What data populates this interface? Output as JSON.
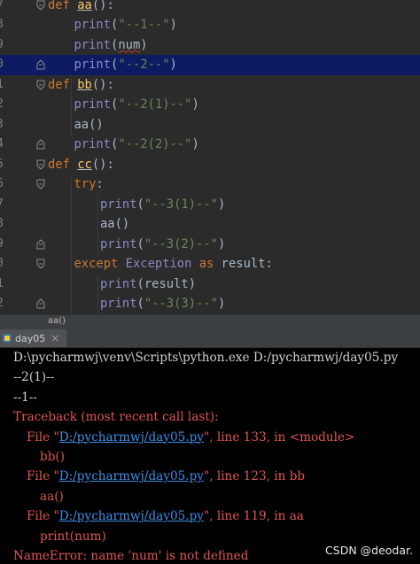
{
  "editor": {
    "lines": [
      {
        "num": "7",
        "indent": 0,
        "tokens": [
          {
            "t": "def ",
            "c": "kw"
          },
          {
            "t": "aa",
            "c": "fn-u"
          },
          {
            "t": "():",
            "c": "plain"
          }
        ],
        "mark": "fold"
      },
      {
        "num": "8",
        "indent": 1,
        "tokens": [
          {
            "t": "print",
            "c": "bi"
          },
          {
            "t": "(",
            "c": "plain"
          },
          {
            "t": "\"--1--\"",
            "c": "str"
          },
          {
            "t": ")",
            "c": "plain"
          }
        ],
        "mark": ""
      },
      {
        "num": "9",
        "indent": 1,
        "tokens": [
          {
            "t": "print",
            "c": "bi"
          },
          {
            "t": "(",
            "c": "plain"
          },
          {
            "t": "num",
            "c": "var-sq"
          },
          {
            "t": ")",
            "c": "plain"
          }
        ],
        "mark": ""
      },
      {
        "num": "0",
        "indent": 1,
        "tokens": [
          {
            "t": "print",
            "c": "bi"
          },
          {
            "t": "(",
            "c": "plain"
          },
          {
            "t": "\"--2--\"",
            "c": "str"
          },
          {
            "t": ")",
            "c": "plain"
          }
        ],
        "mark": "end",
        "active": true
      },
      {
        "num": "1",
        "indent": 0,
        "tokens": [
          {
            "t": "def ",
            "c": "kw"
          },
          {
            "t": "bb",
            "c": "fn-u"
          },
          {
            "t": "():",
            "c": "plain"
          }
        ],
        "mark": "fold"
      },
      {
        "num": "2",
        "indent": 1,
        "tokens": [
          {
            "t": "print",
            "c": "bi"
          },
          {
            "t": "(",
            "c": "plain"
          },
          {
            "t": "\"--2(1)--\"",
            "c": "str"
          },
          {
            "t": ")",
            "c": "plain"
          }
        ],
        "mark": ""
      },
      {
        "num": "3",
        "indent": 1,
        "tokens": [
          {
            "t": "aa",
            "c": "plain"
          },
          {
            "t": "()",
            "c": "plain"
          }
        ],
        "mark": ""
      },
      {
        "num": "4",
        "indent": 1,
        "tokens": [
          {
            "t": "print",
            "c": "bi"
          },
          {
            "t": "(",
            "c": "plain"
          },
          {
            "t": "\"--2(2)--\"",
            "c": "str"
          },
          {
            "t": ")",
            "c": "plain"
          }
        ],
        "mark": "end"
      },
      {
        "num": "5",
        "indent": 0,
        "tokens": [
          {
            "t": "def ",
            "c": "kw"
          },
          {
            "t": "cc",
            "c": "fn-u"
          },
          {
            "t": "():",
            "c": "plain"
          }
        ],
        "mark": "fold"
      },
      {
        "num": "6",
        "indent": 1,
        "tokens": [
          {
            "t": "try",
            "c": "kw"
          },
          {
            "t": ":",
            "c": "plain"
          }
        ],
        "mark": "fold"
      },
      {
        "num": "7",
        "indent": 2,
        "tokens": [
          {
            "t": "print",
            "c": "bi"
          },
          {
            "t": "(",
            "c": "plain"
          },
          {
            "t": "\"--3(1)--\"",
            "c": "str"
          },
          {
            "t": ")",
            "c": "plain"
          }
        ],
        "mark": ""
      },
      {
        "num": "8",
        "indent": 2,
        "tokens": [
          {
            "t": "aa",
            "c": "plain"
          },
          {
            "t": "()",
            "c": "plain"
          }
        ],
        "mark": ""
      },
      {
        "num": "9",
        "indent": 2,
        "tokens": [
          {
            "t": "print",
            "c": "bi"
          },
          {
            "t": "(",
            "c": "plain"
          },
          {
            "t": "\"--3(2)--\"",
            "c": "str"
          },
          {
            "t": ")",
            "c": "plain"
          }
        ],
        "mark": "end"
      },
      {
        "num": "0",
        "indent": 1,
        "tokens": [
          {
            "t": "except ",
            "c": "kw"
          },
          {
            "t": "Exception ",
            "c": "bi"
          },
          {
            "t": "as ",
            "c": "kw"
          },
          {
            "t": "result:",
            "c": "plain"
          }
        ],
        "mark": "fold"
      },
      {
        "num": "1",
        "indent": 2,
        "tokens": [
          {
            "t": "print",
            "c": "bi"
          },
          {
            "t": "(result)",
            "c": "plain"
          }
        ],
        "mark": ""
      },
      {
        "num": "2",
        "indent": 2,
        "tokens": [
          {
            "t": "print",
            "c": "bi"
          },
          {
            "t": "(",
            "c": "plain"
          },
          {
            "t": "\"--3(3)--\"",
            "c": "str"
          },
          {
            "t": ")",
            "c": "plain"
          }
        ],
        "mark": "end"
      }
    ]
  },
  "breadcrumb": {
    "label": "aa()"
  },
  "run_tab": {
    "label": "day05",
    "close": "×",
    "icon": "python-run-icon"
  },
  "console": {
    "lines": [
      {
        "indent": 0,
        "color": "white",
        "parts": [
          {
            "t": "D:\\pycharmwj\\venv\\Scripts\\python.exe D:/pycharmwj/day05.py",
            "k": "text"
          }
        ]
      },
      {
        "indent": 0,
        "color": "white",
        "parts": [
          {
            "t": "--2(1)--",
            "k": "text"
          }
        ]
      },
      {
        "indent": 0,
        "color": "white",
        "parts": [
          {
            "t": "--1--",
            "k": "text"
          }
        ]
      },
      {
        "indent": 0,
        "color": "red",
        "parts": [
          {
            "t": "Traceback (most recent call last):",
            "k": "text"
          }
        ]
      },
      {
        "indent": 1,
        "color": "red",
        "parts": [
          {
            "t": "File \"",
            "k": "text"
          },
          {
            "t": "D:/pycharmwj/day05.py",
            "k": "link"
          },
          {
            "t": "\", line 133, in <module>",
            "k": "text"
          }
        ]
      },
      {
        "indent": 2,
        "color": "red",
        "parts": [
          {
            "t": "bb()",
            "k": "text"
          }
        ]
      },
      {
        "indent": 1,
        "color": "red",
        "parts": [
          {
            "t": "File \"",
            "k": "text"
          },
          {
            "t": "D:/pycharmwj/day05.py",
            "k": "link"
          },
          {
            "t": "\", line 123, in bb",
            "k": "text"
          }
        ]
      },
      {
        "indent": 2,
        "color": "red",
        "parts": [
          {
            "t": "aa()",
            "k": "text"
          }
        ]
      },
      {
        "indent": 1,
        "color": "red",
        "parts": [
          {
            "t": "File \"",
            "k": "text"
          },
          {
            "t": "D:/pycharmwj/day05.py",
            "k": "link"
          },
          {
            "t": "\", line 119, in aa",
            "k": "text"
          }
        ]
      },
      {
        "indent": 2,
        "color": "red",
        "parts": [
          {
            "t": "print(num)",
            "k": "text"
          }
        ]
      },
      {
        "indent": 0,
        "color": "red",
        "parts": [
          {
            "t": "NameError: name 'num' is not defined",
            "k": "text"
          }
        ]
      }
    ]
  },
  "watermark": "CSDN @deodar.",
  "colors": {
    "editor_bg": "#2b2b2b",
    "active_line": "#0d1b63",
    "keyword": "#cc7832",
    "string": "#6a8759",
    "builtin": "#8888c6",
    "console_bg": "#000000",
    "error": "#e05555",
    "link": "#3d8ee8"
  }
}
